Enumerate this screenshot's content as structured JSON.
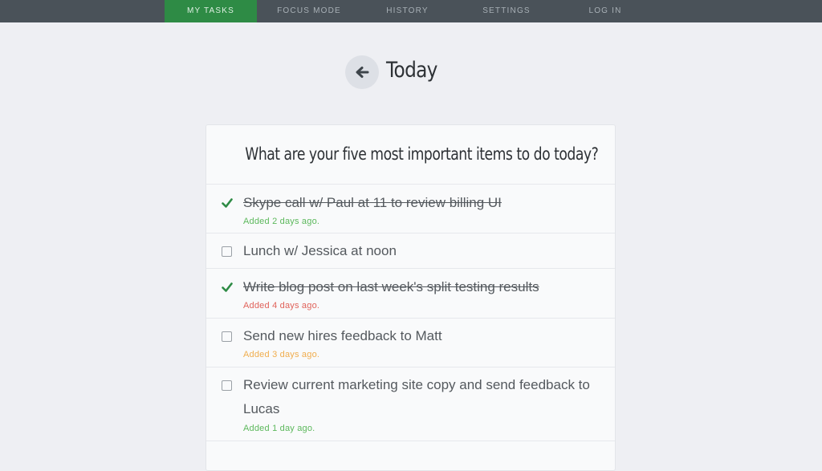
{
  "nav": {
    "items": [
      {
        "label": "MY TASKS"
      },
      {
        "label": "FOCUS MODE"
      },
      {
        "label": "HISTORY"
      },
      {
        "label": "SETTINGS"
      },
      {
        "label": "LOG IN"
      }
    ],
    "active_index": 0
  },
  "header": {
    "back_icon": "arrow-left-icon",
    "title": "Today"
  },
  "card": {
    "question": "What are your five most important items to do today?",
    "tasks": [
      {
        "text": "Skype call w/ Paul at 11 to review billing UI",
        "done": true,
        "meta": "Added 2 days ago.",
        "meta_color": "#5cb85c"
      },
      {
        "text": "Lunch w/ Jessica at noon",
        "done": false,
        "meta": "",
        "meta_color": ""
      },
      {
        "text": "Write blog post on last week's split testing results",
        "done": true,
        "meta": "Added 4 days ago.",
        "meta_color": "#e0625a"
      },
      {
        "text": "Send new hires feedback to Matt",
        "done": false,
        "meta": "Added 3 days ago.",
        "meta_color": "#f0ad4e"
      },
      {
        "text": "Review current marketing site copy and send feedback to Lucas",
        "done": false,
        "meta": "Added 1 day ago.",
        "meta_color": "#5cb85c"
      }
    ]
  },
  "colors": {
    "nav_bg": "#4a5259",
    "nav_active": "#2e8b45",
    "check_green": "#2e8b45",
    "page_bg": "#eeeff3"
  }
}
